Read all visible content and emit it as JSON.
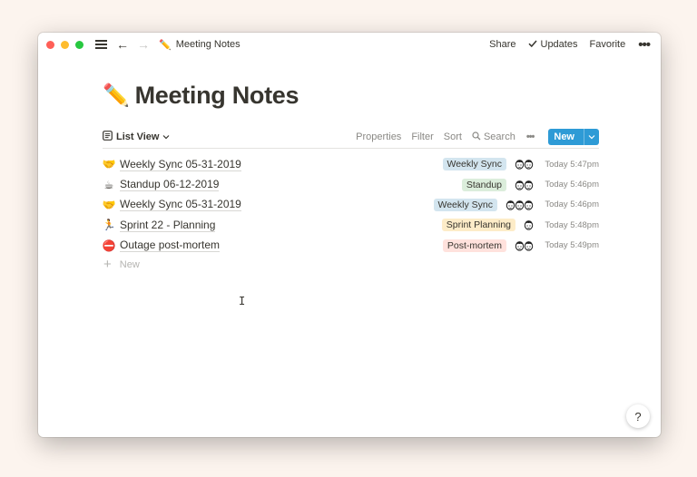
{
  "titlebar": {
    "breadcrumb_emoji": "✏️",
    "breadcrumb_label": "Meeting Notes",
    "share_label": "Share",
    "updates_label": "Updates",
    "favorite_label": "Favorite"
  },
  "page": {
    "emoji": "✏️",
    "title": "Meeting Notes"
  },
  "toolbar": {
    "view_label": "List View",
    "properties_label": "Properties",
    "filter_label": "Filter",
    "sort_label": "Sort",
    "search_label": "Search",
    "new_label": "New"
  },
  "rows": [
    {
      "emoji": "🤝",
      "title": "Weekly Sync 05-31-2019",
      "tag": "Weekly Sync",
      "tag_bg": "#d3e5ef",
      "time": "Today 5:47pm",
      "avatars": 2
    },
    {
      "emoji": "☕",
      "title": "Standup 06-12-2019",
      "tag": "Standup",
      "tag_bg": "#dbeddb",
      "time": "Today 5:46pm",
      "avatars": 2
    },
    {
      "emoji": "🤝",
      "title": "Weekly Sync 05-31-2019",
      "tag": "Weekly Sync",
      "tag_bg": "#d3e5ef",
      "time": "Today 5:46pm",
      "avatars": 3
    },
    {
      "emoji": "🏃",
      "title": "Sprint 22 - Planning",
      "tag": "Sprint Planning",
      "tag_bg": "#fdecc8",
      "time": "Today 5:48pm",
      "avatars": 1
    },
    {
      "emoji": "⛔",
      "title": "Outage post-mortem",
      "tag": "Post-mortem",
      "tag_bg": "#ffe2dd",
      "time": "Today 5:49pm",
      "avatars": 2
    }
  ],
  "new_row_label": "New",
  "help_label": "?",
  "colors": {
    "accent": "#2e9bd6",
    "text": "#37352f",
    "muted": "#8a8985"
  }
}
